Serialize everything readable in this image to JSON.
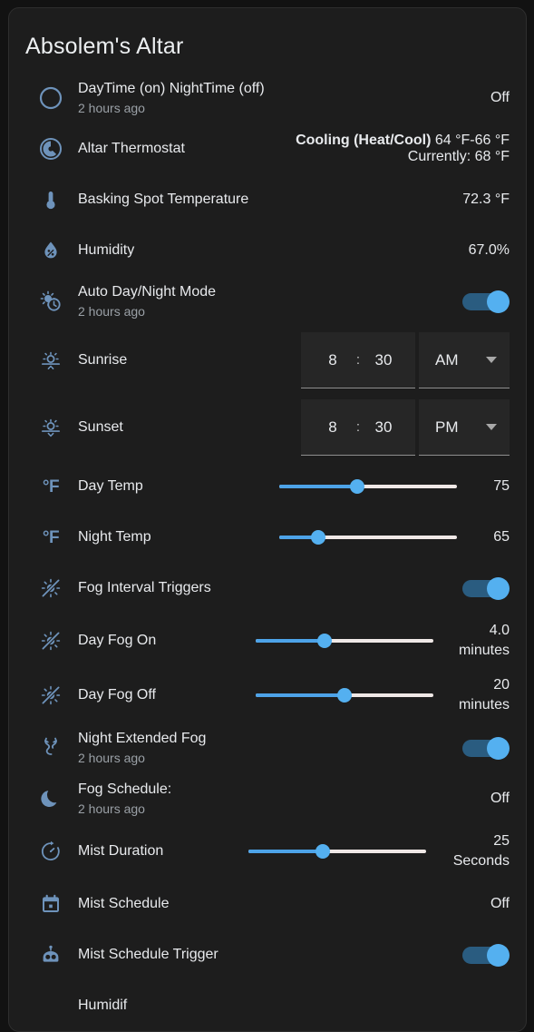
{
  "card": {
    "title": "Absolem's Altar"
  },
  "colors": {
    "accent": "#54b0f0",
    "icon": "#6e93bb",
    "card_bg": "#1d1d1d",
    "page_bg": "#121212",
    "text": "#e8eaed",
    "subtext": "#9aa0a6"
  },
  "rows": [
    {
      "icon": "circle-icon",
      "label": "DayTime (on) NightTime (off)",
      "sub": "2 hours ago",
      "value": "Off",
      "type": "value"
    },
    {
      "icon": "thermostat-dial-icon",
      "label": "Altar Thermostat",
      "value_bold": "Cooling (Heat/Cool)",
      "value_rest": " 64 °F-66 °F",
      "value_sub": "Currently: 68 °F",
      "type": "thermostat"
    },
    {
      "icon": "thermometer-icon",
      "label": "Basking Spot Temperature",
      "value": "72.3 °F",
      "type": "value"
    },
    {
      "icon": "humidity-drop-icon",
      "label": "Humidity",
      "value": "67.0%",
      "type": "value"
    },
    {
      "icon": "sun-clock-icon",
      "label": "Auto Day/Night Mode",
      "sub": "2 hours ago",
      "toggle": "on",
      "type": "toggle"
    },
    {
      "icon": "sunrise-icon",
      "label": "Sunrise",
      "hour": "8",
      "colon": ":",
      "minute": "30",
      "meridiem": "AM",
      "type": "time"
    },
    {
      "icon": "sunset-icon",
      "label": "Sunset",
      "hour": "8",
      "colon": ":",
      "minute": "30",
      "meridiem": "PM",
      "type": "time"
    },
    {
      "icon": "degrees-f-icon",
      "icon_text": "°F",
      "label": "Day Temp",
      "value": "75",
      "slider_percent": 44,
      "type": "slider"
    },
    {
      "icon": "degrees-f-icon",
      "icon_text": "°F",
      "label": "Night Temp",
      "value": "65",
      "slider_percent": 22,
      "type": "slider"
    },
    {
      "icon": "sun-off-icon",
      "label": "Fog Interval Triggers",
      "toggle": "on",
      "type": "toggle"
    },
    {
      "icon": "sun-off-icon",
      "label": "Day Fog On",
      "value": "4.0",
      "unit": "minutes",
      "slider_percent": 39,
      "type": "slider-unit"
    },
    {
      "icon": "sun-off-icon",
      "label": "Day Fog Off",
      "value": "20",
      "unit": "minutes",
      "slider_percent": 50,
      "type": "slider-unit"
    },
    {
      "icon": "fog-squiggle-icon",
      "label": "Night Extended Fog",
      "sub": "2 hours ago",
      "toggle": "on",
      "type": "toggle"
    },
    {
      "icon": "moon-icon",
      "label": "Fog Schedule:",
      "sub": "2 hours ago",
      "value": "Off",
      "type": "value"
    },
    {
      "icon": "timer-icon",
      "label": "Mist Duration",
      "value": "25",
      "unit": "Seconds",
      "slider_percent": 42,
      "type": "slider-unit"
    },
    {
      "icon": "calendar-icon",
      "label": "Mist Schedule",
      "value": "Off",
      "type": "value"
    },
    {
      "icon": "robot-icon",
      "label": "Mist Schedule Trigger",
      "toggle": "on",
      "type": "toggle"
    },
    {
      "icon": "humidifier-icon",
      "label": "Humidif",
      "type": "cutoff"
    }
  ]
}
